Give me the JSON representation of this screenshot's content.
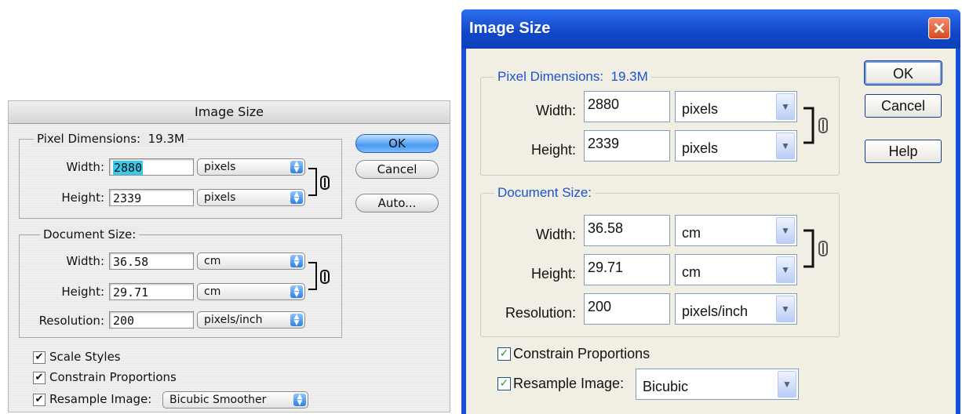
{
  "mac_dialog": {
    "title": "Image Size",
    "pixel_dimensions": {
      "legend": "Pixel Dimensions:  19.3M",
      "width_label": "Width:",
      "width_value": "2880",
      "width_unit": "pixels",
      "height_label": "Height:",
      "height_value": "2339",
      "height_unit": "pixels"
    },
    "document_size": {
      "legend": "Document Size:",
      "width_label": "Width:",
      "width_value": "36.58",
      "width_unit": "cm",
      "height_label": "Height:",
      "height_value": "29.71",
      "height_unit": "cm",
      "resolution_label": "Resolution:",
      "resolution_value": "200",
      "resolution_unit": "pixels/inch"
    },
    "buttons": {
      "ok": "OK",
      "cancel": "Cancel",
      "auto": "Auto..."
    },
    "checkboxes": {
      "scale_styles": "Scale Styles",
      "constrain": "Constrain Proportions",
      "resample": "Resample Image:"
    },
    "resample_method": "Bicubic Smoother"
  },
  "win_dialog": {
    "title": "Image Size",
    "close_glyph": "✕",
    "pixel_dimensions": {
      "legend": "Pixel Dimensions:  19.3M",
      "width_label": "Width:",
      "width_value": "2880",
      "width_unit": "pixels",
      "height_label": "Height:",
      "height_value": "2339",
      "height_unit": "pixels"
    },
    "document_size": {
      "legend": "Document Size:",
      "width_label": "Width:",
      "width_value": "36.58",
      "width_unit": "cm",
      "height_label": "Height:",
      "height_value": "29.71",
      "height_unit": "cm",
      "resolution_label": "Resolution:",
      "resolution_value": "200",
      "resolution_unit": "pixels/inch"
    },
    "buttons": {
      "ok": "OK",
      "cancel": "Cancel",
      "help": "Help"
    },
    "checkboxes": {
      "constrain": "Constrain Proportions",
      "resample": "Resample Image:"
    },
    "resample_method": "Bicubic"
  },
  "colors": {
    "win_titlebar": "#1147c8",
    "win_legend": "#1a52d0",
    "mac_default_button": "#4a9af2",
    "mac_selection": "#3cc8e8"
  }
}
